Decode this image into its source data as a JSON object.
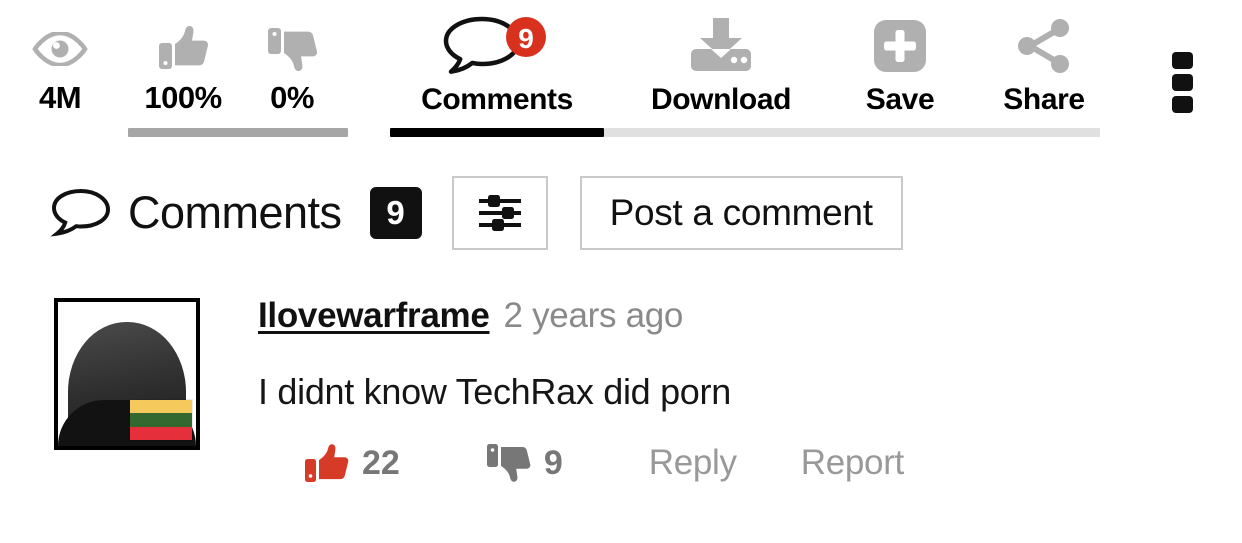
{
  "topbar": {
    "stats": [
      {
        "id": "views",
        "icon": "eye-icon",
        "label": "4M"
      },
      {
        "id": "likes",
        "icon": "thumbs-up-icon",
        "label": "100%"
      },
      {
        "id": "dislikes",
        "icon": "thumbs-down-icon",
        "label": "0%"
      }
    ],
    "tabs": [
      {
        "id": "comments",
        "icon": "comment-bubble-icon",
        "label": "Comments",
        "badge": "9",
        "active": true
      },
      {
        "id": "download",
        "icon": "download-icon",
        "label": "Download",
        "active": false
      },
      {
        "id": "save",
        "icon": "plus-square-icon",
        "label": "Save",
        "active": false
      },
      {
        "id": "share",
        "icon": "share-icon",
        "label": "Share",
        "active": false
      }
    ],
    "overflow_menu": "more-options-icon"
  },
  "comments_header": {
    "icon": "comment-bubble-icon",
    "title": "Comments",
    "count": "9",
    "filter_icon": "sliders-filter-icon",
    "post_button": "Post a comment"
  },
  "comment": {
    "avatar": {
      "icon": "user-silhouette-avatar",
      "flag": "lithuania-flag",
      "flag_colors": [
        "#f5c95c",
        "#33682f",
        "#e5303c"
      ]
    },
    "username": "Ilovewarframe",
    "timestamp": "2 years ago",
    "text": "I didnt know TechRax did porn",
    "likes": "22",
    "dislikes": "9",
    "reply_label": "Reply",
    "report_label": "Report"
  },
  "colors": {
    "accent_red": "#d63b28",
    "badge_red": "#d8321f",
    "icon_gray": "#b0b0b0",
    "muted_text": "#999999",
    "active_underline": "#000000",
    "inactive_underline": "#e0e0e0",
    "ratio_bar": "#a6a6a6"
  }
}
